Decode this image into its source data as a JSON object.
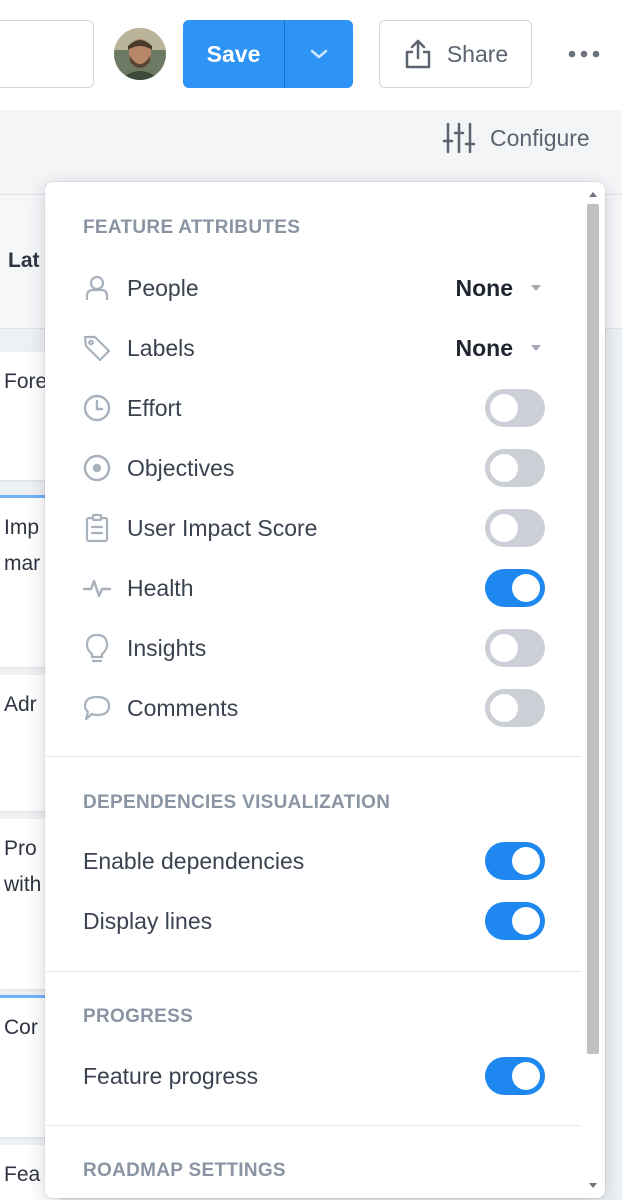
{
  "toolbar": {
    "save_label": "Save",
    "share_label": "Share",
    "configure_label": "Configure"
  },
  "board": {
    "column_title": "Lat",
    "cards": [
      "Fore",
      "Imp",
      "mar",
      "Adr",
      "Pro",
      "with",
      "Cor",
      "Fea"
    ]
  },
  "panel": {
    "feature_attributes": {
      "title": "FEATURE ATTRIBUTES",
      "people": {
        "label": "People",
        "value": "None"
      },
      "labels": {
        "label": "Labels",
        "value": "None"
      },
      "effort": {
        "label": "Effort",
        "on": false
      },
      "objectives": {
        "label": "Objectives",
        "on": false
      },
      "user_impact": {
        "label": "User Impact Score",
        "on": false
      },
      "health": {
        "label": "Health",
        "on": true
      },
      "insights": {
        "label": "Insights",
        "on": false
      },
      "comments": {
        "label": "Comments",
        "on": false
      }
    },
    "dependencies": {
      "title": "DEPENDENCIES VISUALIZATION",
      "enable": {
        "label": "Enable dependencies",
        "on": true
      },
      "lines": {
        "label": "Display lines",
        "on": true
      }
    },
    "progress": {
      "title": "PROGRESS",
      "feature_progress": {
        "label": "Feature progress",
        "on": true
      }
    },
    "roadmap_settings": {
      "title": "ROADMAP SETTINGS"
    }
  },
  "colors": {
    "accent": "#2d93f5",
    "toggle_on": "#1e88f0",
    "toggle_off": "#ccd0d6",
    "section_title": "#8a94a3"
  },
  "icons": {
    "people": "person-icon",
    "labels": "tag-icon",
    "effort": "clock-icon",
    "objectives": "target-icon",
    "user_impact": "clipboard-icon",
    "health": "pulse-icon",
    "insights": "lightbulb-icon",
    "comments": "speech-bubble-icon"
  }
}
